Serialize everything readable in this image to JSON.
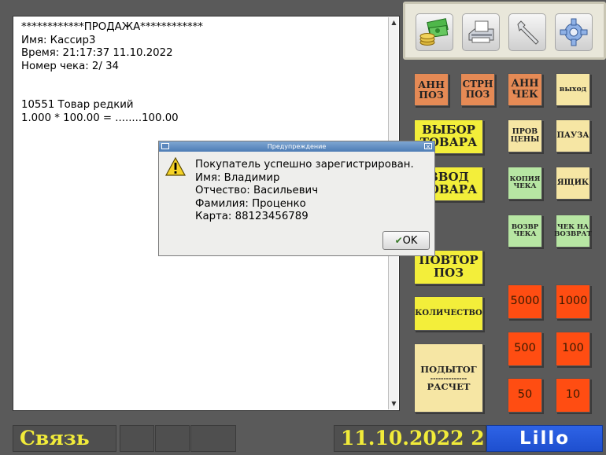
{
  "receipt": {
    "lines": "************ПРОДАЖА************\nИмя: Кассир3\nВремя: 21:17:37 11.10.2022\nНомер чека: 2/ 34\n\n\n10551 Товар редкий\n1.000 * 100.00 = ........100.00"
  },
  "toolbar": {
    "icons": [
      "money-icon",
      "printer-icon",
      "wrench-icon",
      "gear-icon"
    ]
  },
  "buttons": {
    "ann_pos": "АНН ПОЗ",
    "strn_pos": "СТРН ПОЗ",
    "ann_chek": "АНН ЧЕК",
    "exit": "выход",
    "select_item": "ВЫБОР ТОВАРА",
    "check": "ПРОВ ЦЕНЫ",
    "pause": "ПАУЗА",
    "input_item": "ВВОД ТОВАРА",
    "copy_check": "КОПИЯ ЧЕКА",
    "drawer": "ЯЩИК",
    "return_check": "ВОЗВР ЧЕКА",
    "check_return": "ЧЕК НА ВОЗВРАТ",
    "repeat_pos": "ПОВТОР ПОЗ",
    "quantity": "КОЛИЧЕСТВО",
    "subtotal": "ПОДЫТОГ",
    "subtotal_sep": "--------------",
    "calc": "РАСЧЕТ",
    "n5000": "5000",
    "n1000": "1000",
    "n500": "500",
    "n100": "100",
    "n50": "50",
    "n10": "10"
  },
  "dialog": {
    "title": "Предупреждение",
    "message": "Покупатель успешно зарегистрирован.\nИмя: Владимир\nОтчество: Васильевич\nФамилия: Проценко\nКарта: 88123456789",
    "ok": "OK"
  },
  "status": {
    "connection": "Связь",
    "date": "11.10.2022 2",
    "logo": "Lillo"
  },
  "colors": {
    "orange": "#e58a55",
    "yellow": "#f3ee3a",
    "light_yellow": "#f6e6a4",
    "light_green": "#b7e6a3",
    "red": "#ff4d12",
    "status_text": "#f1eb3a"
  }
}
